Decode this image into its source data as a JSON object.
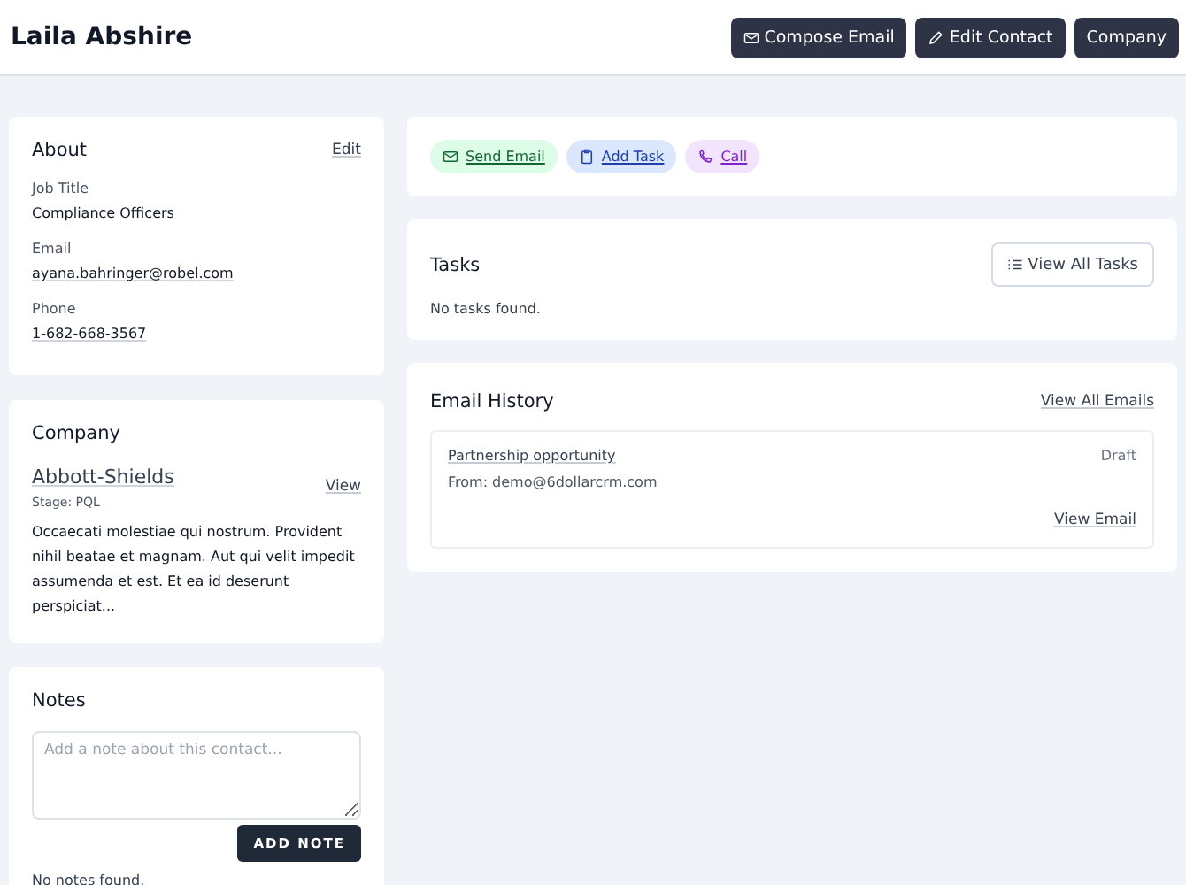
{
  "header": {
    "title": "Laila Abshire",
    "buttons": [
      {
        "label": "Compose Email",
        "kind": "email"
      },
      {
        "label": "Edit Contact",
        "kind": "edit"
      },
      {
        "label": "Company",
        "kind": "plain"
      }
    ]
  },
  "about": {
    "title": "About",
    "edit": "Edit",
    "fields": [
      {
        "label": "Job Title",
        "value": "Compliance Officers",
        "kind": "text"
      },
      {
        "label": "Email",
        "value": "ayana.bahringer@robel.com",
        "kind": "link"
      },
      {
        "label": "Phone",
        "value": "1-682-668-3567",
        "kind": "link"
      }
    ]
  },
  "company": {
    "title": "Company",
    "name": "Abbott-Shields",
    "stage": "Stage: PQL",
    "view": "View",
    "description": "Occaecati molestiae qui nostrum. Provident nihil beatae et magnam. Aut qui velit impedit assumenda et est. Et ea id deserunt perspiciat..."
  },
  "notes": {
    "title": "Notes",
    "placeholder": "Add a note about this contact...",
    "button": "ADD NOTE",
    "empty": "No notes found."
  },
  "quick_actions": [
    {
      "label": "Send Email",
      "kind": "email"
    },
    {
      "label": "Add Task",
      "kind": "task"
    },
    {
      "label": "Call",
      "kind": "call"
    }
  ],
  "tasks": {
    "title": "Tasks",
    "button": "View All Tasks",
    "empty": "No tasks found."
  },
  "email_history": {
    "title": "Email History",
    "link": "View All Emails",
    "emails": [
      {
        "subject": "Partnership opportunity",
        "status": "Draft",
        "from": "From: demo@6dollarcrm.com",
        "link": "View Email"
      }
    ]
  }
}
